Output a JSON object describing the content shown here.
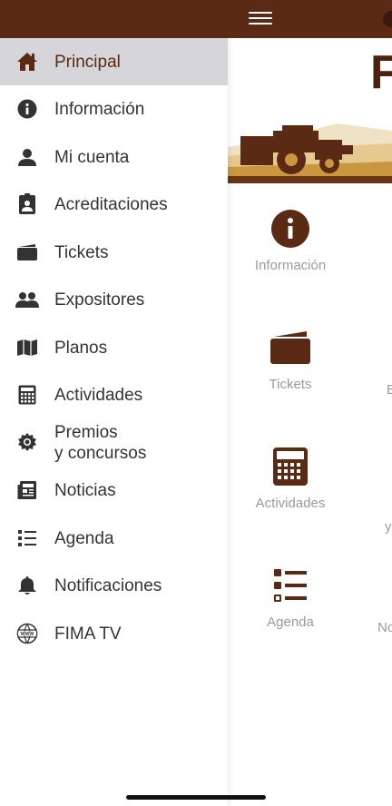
{
  "colors": {
    "brand": "#5a2a14",
    "active_bg": "#d6d5da",
    "text": "#333333",
    "muted": "#9a9a9a"
  },
  "main": {
    "brand_letter": "F",
    "grid": [
      {
        "label": "Información",
        "icon": "info-icon"
      },
      {
        "label": "Tickets",
        "icon": "ticket-icon"
      },
      {
        "label": "Actividades",
        "icon": "calculator-icon"
      },
      {
        "label": "Agenda",
        "icon": "list-icon"
      }
    ],
    "grid_right_partial": [
      "E",
      "y",
      "No"
    ]
  },
  "drawer": {
    "items": [
      {
        "label": "Principal",
        "icon": "home-icon",
        "active": true
      },
      {
        "label": "Información",
        "icon": "info-icon"
      },
      {
        "label": "Mi cuenta",
        "icon": "user-icon"
      },
      {
        "label": "Acreditaciones",
        "icon": "badge-icon"
      },
      {
        "label": "Tickets",
        "icon": "ticket-icon"
      },
      {
        "label": "Expositores",
        "icon": "users-icon"
      },
      {
        "label": "Planos",
        "icon": "map-icon"
      },
      {
        "label": "Actividades",
        "icon": "calculator-icon"
      },
      {
        "label": "Premios\ny concursos",
        "icon": "award-icon"
      },
      {
        "label": "Noticias",
        "icon": "newspaper-icon"
      },
      {
        "label": "Agenda",
        "icon": "list-icon"
      },
      {
        "label": "Notificaciones",
        "icon": "bell-icon"
      },
      {
        "label": "FIMA TV",
        "icon": "www-globe-icon"
      }
    ]
  }
}
